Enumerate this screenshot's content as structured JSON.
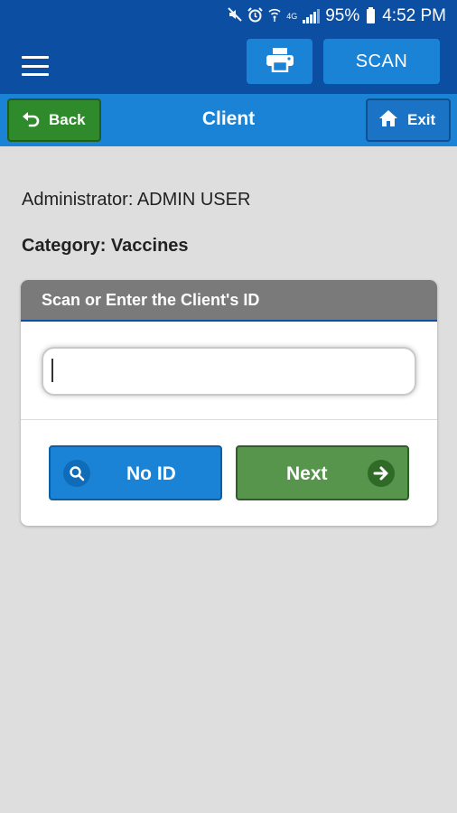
{
  "status_bar": {
    "battery": "95%",
    "time": "4:52 PM",
    "icons": [
      "mute-icon",
      "alarm-icon",
      "wifi-icon",
      "lte-icon",
      "signal-icon",
      "battery-icon"
    ],
    "lte_label": "4G"
  },
  "toolbar": {
    "menu_icon": "hamburger-menu-icon",
    "print_icon": "printer-icon",
    "scan_label": "SCAN",
    "background": "#0b4ea2",
    "button_color": "#1a83d6"
  },
  "nav": {
    "back_label": "Back",
    "back_icon": "undo-arrow-icon",
    "title": "Client",
    "exit_label": "Exit",
    "exit_icon": "home-icon",
    "background": "#1a83d6",
    "back_color": "#2e8a2a"
  },
  "content": {
    "administrator": "Administrator: ADMIN USER",
    "category": "Category: Vaccines"
  },
  "card": {
    "header": "Scan or Enter the Client's ID",
    "input_value": "",
    "noid_label": "No ID",
    "noid_icon": "search-icon",
    "next_label": "Next",
    "next_icon": "arrow-right-icon",
    "noid_color": "#1a83d6",
    "next_color": "#57944c"
  }
}
